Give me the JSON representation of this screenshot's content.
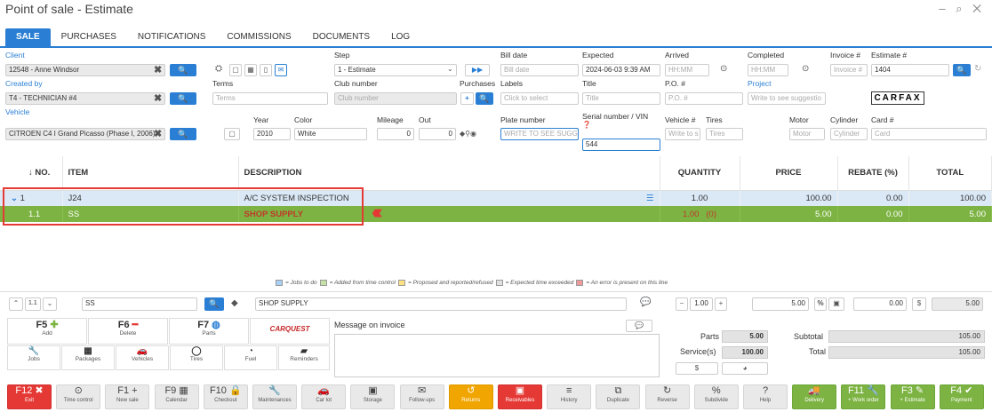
{
  "window": {
    "title": "Point of sale - Estimate",
    "controls": "– ⌕ ✕"
  },
  "tabs": [
    "SALE",
    "PURCHASES",
    "NOTIFICATIONS",
    "COMMISSIONS",
    "DOCUMENTS",
    "LOG"
  ],
  "header": {
    "client_label": "Client",
    "client_value": "12548 - Anne Windsor",
    "created_by_label": "Created by",
    "created_by_value": "T4 - TECHNICIAN #4",
    "vehicle_label": "Vehicle",
    "vehicle_value": "CITROEN C4 I Grand Picasso (Phase I, 2006)",
    "terms_label": "Terms",
    "terms_placeholder": "Terms",
    "year_label": "Year",
    "year_value": "2010",
    "color_label": "Color",
    "color_value": "White",
    "mileage_label": "Mileage",
    "mileage_value": "0",
    "out_label": "Out",
    "out_value": "0",
    "step_label": "Step",
    "step_value": "1 - Estimate",
    "club_label": "Club number",
    "club_placeholder": "Club number",
    "purchases_label": "Purchases",
    "labels_label": "Labels",
    "labels_placeholder": "Click to select",
    "plate_label": "Plate number",
    "plate_placeholder": "WRITE TO SEE SUGGE",
    "bill_date_label": "Bill date",
    "bill_date_placeholder": "Bill date",
    "expected_label": "Expected",
    "expected_value": "2024-06-03 9:39 AM",
    "title_label": "Title",
    "title_placeholder": "Title",
    "serial_label": "Serial number / VIN",
    "serial_value": "544",
    "arrived_label": "Arrived",
    "arrived_placeholder": "HH:MM",
    "po_label": "P.O. #",
    "po_placeholder": "P.O. #",
    "vehicle_no_label": "Vehicle #",
    "vehicle_no_placeholder": "Write to s",
    "tires_label": "Tires",
    "tires_placeholder": "Tires",
    "completed_label": "Completed",
    "completed_placeholder": "HH:MM",
    "project_label": "Project",
    "project_placeholder": "Write to see suggestio",
    "motor_label": "Motor",
    "motor_placeholder": "Motor",
    "invoice_label": "Invoice #",
    "invoice_placeholder": "Invoice #",
    "estimate_label": "Estimate #",
    "estimate_value": "1404",
    "cylinder_label": "Cylinder",
    "cylinder_placeholder": "Cylinder",
    "card_label": "Card #",
    "card_placeholder": "Card",
    "carfax": "CARFAX"
  },
  "grid": {
    "columns": [
      "↓ NO.",
      "ITEM",
      "DESCRIPTION",
      "QUANTITY",
      "PRICE",
      "REBATE (%)",
      "TOTAL"
    ],
    "rows": [
      {
        "no": "1",
        "item": "J24",
        "description": "A/C SYSTEM INSPECTION",
        "quantity": "1.00",
        "qty_extra": "",
        "price": "100.00",
        "rebate": "0.00",
        "total": "100.00"
      },
      {
        "no": "1.1",
        "item": "SS",
        "description": "SHOP SUPPLY",
        "quantity": "1.00",
        "qty_extra": "(0)",
        "price": "5.00",
        "rebate": "0.00",
        "total": "5.00"
      }
    ]
  },
  "legend": {
    "jobs": "= Jobs to do",
    "time": "= Added from time control",
    "proposed": "= Proposed and reported/refused",
    "exceeded": "= Expected time exceeded",
    "error": "= An error is present on this line"
  },
  "editbar": {
    "line": "1.1",
    "item": "SS",
    "description": "SHOP SUPPLY",
    "qty": "1.00",
    "price": "5.00",
    "rebate": "0.00",
    "total": "5.00"
  },
  "fkeys": [
    {
      "k": "F5",
      "s": "Add"
    },
    {
      "k": "F6",
      "s": "Delete"
    },
    {
      "k": "F7",
      "s": "Parts"
    }
  ],
  "carquest": "CARQUEST",
  "cats": [
    "Jobs",
    "Packages",
    "Vehicles",
    "Tires",
    "Fuel",
    "Reminders"
  ],
  "message_label": "Message on invoice",
  "totals": {
    "parts_label": "Parts",
    "parts": "5.00",
    "service_label": "Service(s)",
    "service": "100.00",
    "subtotal_label": "Subtotal",
    "subtotal": "105.00",
    "total_label": "Total",
    "total": "105.00"
  },
  "toolbar": [
    {
      "k": "F12 ✖",
      "s": "Exit",
      "c": "red"
    },
    {
      "k": "⊙",
      "s": "Time control",
      "c": ""
    },
    {
      "k": "F1 +",
      "s": "New sale",
      "c": ""
    },
    {
      "k": "F9 ▦",
      "s": "Calendar",
      "c": ""
    },
    {
      "k": "F10 🔒",
      "s": "Checkout",
      "c": ""
    },
    {
      "k": "🔧",
      "s": "Maintenances",
      "c": ""
    },
    {
      "k": "🚗",
      "s": "Car lot",
      "c": ""
    },
    {
      "k": "▣",
      "s": "Storage",
      "c": ""
    },
    {
      "k": "✉",
      "s": "Follow-ups",
      "c": ""
    },
    {
      "k": "↺",
      "s": "Returns",
      "c": "org"
    },
    {
      "k": "▣",
      "s": "Receivables",
      "c": "red"
    },
    {
      "k": "≡",
      "s": "History",
      "c": ""
    },
    {
      "k": "⧉",
      "s": "Duplicate",
      "c": ""
    },
    {
      "k": "↻",
      "s": "Reverse",
      "c": ""
    },
    {
      "k": "%",
      "s": "Subdivide",
      "c": ""
    },
    {
      "k": "?",
      "s": "Help",
      "c": ""
    },
    {
      "k": "🚚",
      "s": "Delivery",
      "c": "grn"
    },
    {
      "k": "F11 🔧",
      "s": "+ Work order",
      "c": "grn"
    },
    {
      "k": "F3 ✎",
      "s": "+ Estimate",
      "c": "grn"
    },
    {
      "k": "F4 ✔",
      "s": "Payment",
      "c": "grn"
    }
  ]
}
